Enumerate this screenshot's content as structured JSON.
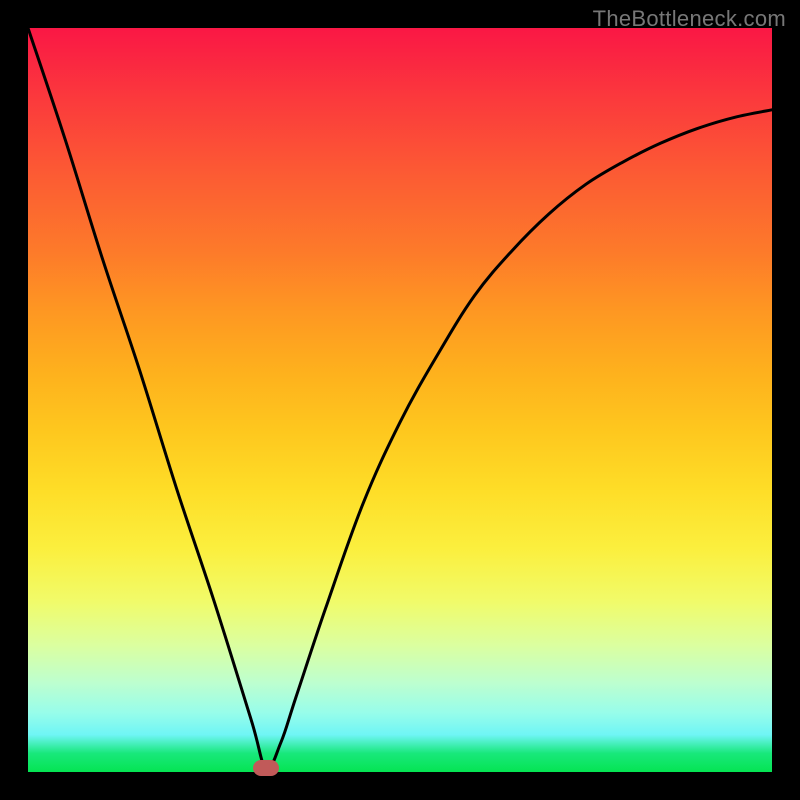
{
  "watermark": "TheBottleneck.com",
  "chart_data": {
    "type": "line",
    "title": "",
    "xlabel": "",
    "ylabel": "",
    "xlim": [
      0,
      100
    ],
    "ylim": [
      0,
      100
    ],
    "grid": false,
    "series": [
      {
        "name": "curve",
        "x": [
          0,
          5,
          10,
          15,
          20,
          25,
          30,
          32,
          34,
          36,
          40,
          45,
          50,
          55,
          60,
          65,
          70,
          75,
          80,
          85,
          90,
          95,
          100
        ],
        "y": [
          100,
          85,
          69,
          54,
          38,
          23,
          7,
          0.5,
          4,
          10,
          22,
          36,
          47,
          56,
          64,
          70,
          75,
          79,
          82,
          84.5,
          86.5,
          88,
          89
        ]
      }
    ],
    "marker": {
      "x": 32,
      "y": 0.5,
      "color": "#c15a59"
    },
    "gradient_stops": [
      {
        "pos": 0,
        "color": "#fa1745"
      },
      {
        "pos": 0.5,
        "color": "#fedd27"
      },
      {
        "pos": 1,
        "color": "#05e452"
      }
    ]
  }
}
